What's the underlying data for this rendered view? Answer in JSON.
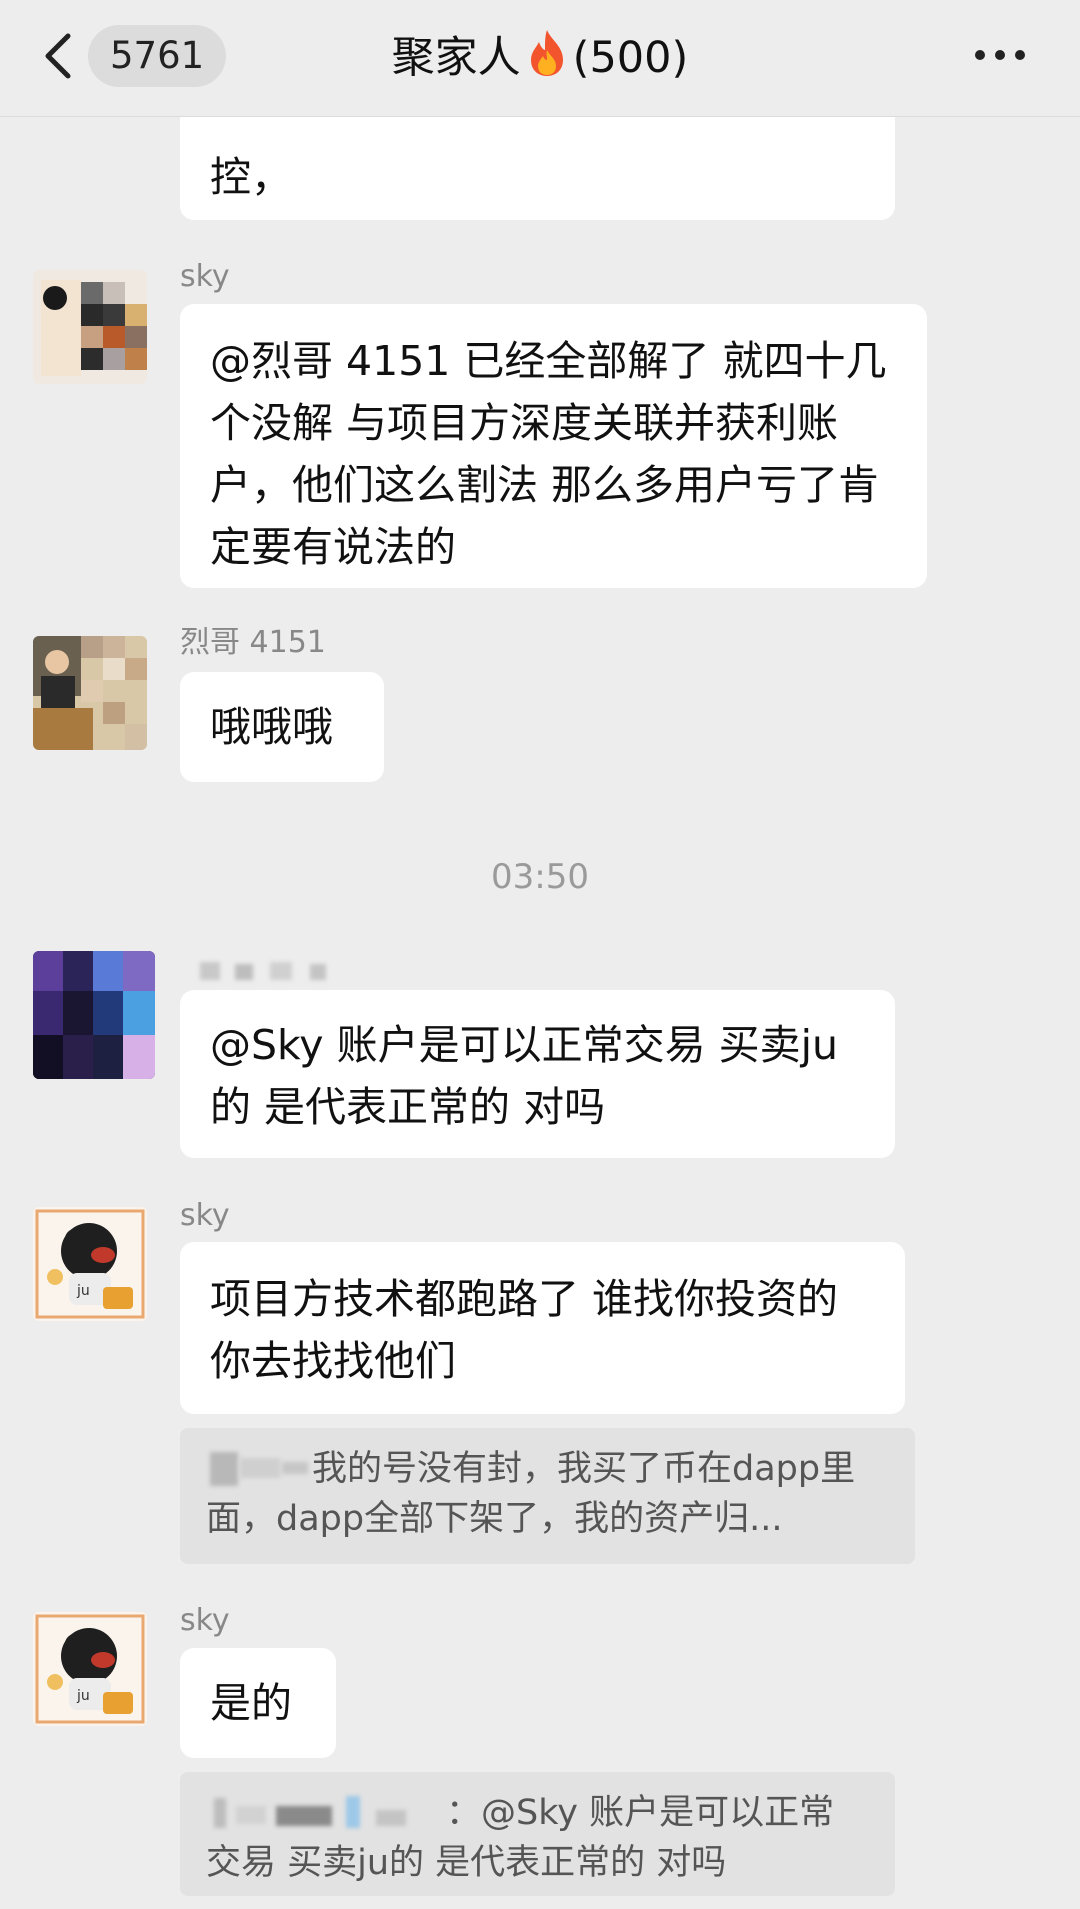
{
  "header": {
    "back_label": "5761",
    "title": "聚家人",
    "title_emoji": "🔥",
    "member_count": "(500)"
  },
  "messages": {
    "m0": {
      "text_line2": "控，"
    },
    "m1": {
      "sender": "sky",
      "text": "@烈哥 4151 已经全部解了 就四十几个没解 与项目方深度关联并获利账户，他们这么割法 那么多用户亏了肯定要有说法的"
    },
    "m2": {
      "sender": "烈哥 4151",
      "text": "哦哦哦"
    },
    "time": "03:50",
    "m3": {
      "text": "@Sky 账户是可以正常交易 买卖ju的 是代表正常的 对吗"
    },
    "m4": {
      "sender": "sky",
      "text": "项目方技术都跑路了 谁找你投资的你去找找他们",
      "quote": "我的号没有封，我买了币在dapp里面，dapp全部下架了，我的资产归..."
    },
    "m5": {
      "sender": "sky",
      "text": "是的",
      "quote": "：@Sky 账户是可以正常交易 买卖ju的 是代表正常的 对吗"
    }
  },
  "colors": {
    "background": "#ededed",
    "bubble": "#ffffff",
    "quote": "#e2e2e2"
  }
}
